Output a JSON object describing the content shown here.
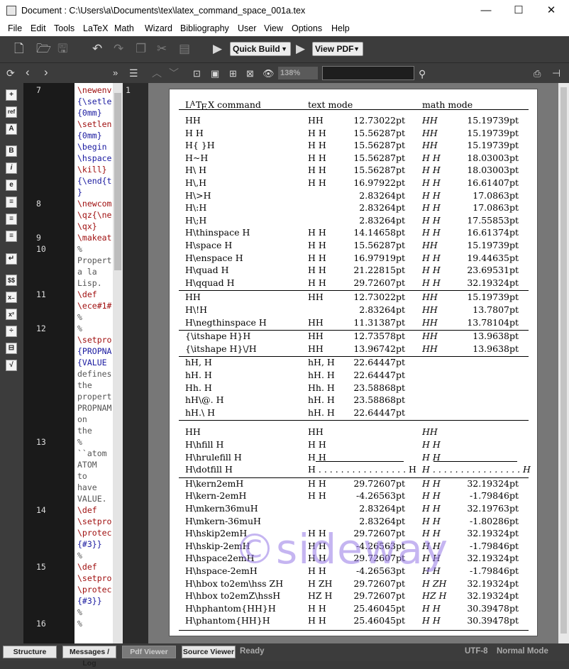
{
  "window": {
    "title": "Document : C:\\Users\\a\\Documents\\tex\\latex_command_space_001a.tex",
    "min": "—",
    "max": "☐",
    "close": "✕"
  },
  "menu": [
    "File",
    "Edit",
    "Tools",
    "LaTeX",
    "Math",
    "Wizard",
    "Bibliography",
    "User",
    "View",
    "Options",
    "Help"
  ],
  "toolbar": {
    "build_label": "Quick Build",
    "viewer_label": "View PDF",
    "zoom": "138%"
  },
  "line_numbers": [
    "7",
    "8",
    "9",
    "10",
    "11",
    "12",
    "13",
    "14",
    "15",
    "16"
  ],
  "pdf_page_number": "1",
  "code_lines": [
    "\\newenv",
    "{\\setle",
    "{0mm}",
    "\\setlen",
    "{0mm}",
    "\\begin",
    "\\hspace",
    "\\kill}",
    "{\\end{t",
    "}",
    "\\newcom",
    "\\qz{\\ne",
    "\\qx}",
    "\\makeat",
    "%",
    "Propert",
    "a la",
    "Lisp.",
    "\\def",
    "\\ece#1#",
    "%",
    "%",
    "\\setpro",
    "{PROPNA",
    "{VALUE",
    "defines",
    "the",
    "propert",
    "PROPNAM",
    "on",
    "the",
    "%",
    "``atom",
    "ATOM",
    "to",
    "have",
    "VALUE.",
    "\\def",
    "\\setpro",
    "\\protec",
    "{#3}}",
    "%",
    "\\def",
    "\\setpro",
    "\\protec",
    "{#3}}",
    "%",
    "%"
  ],
  "table": {
    "headers": [
      "LATEX command",
      "text mode",
      "math mode"
    ],
    "rows": [
      [
        "HH",
        "HH",
        "12.73022pt",
        "HH",
        "15.19739pt"
      ],
      [
        "H H",
        "H H",
        "15.56287pt",
        "HH",
        "15.19739pt"
      ],
      [
        "H{ }H",
        "H H",
        "15.56287pt",
        "HH",
        "15.19739pt"
      ],
      [
        "H~H",
        "H H",
        "15.56287pt",
        "H H",
        "18.03003pt"
      ],
      [
        "H\\ H",
        "H H",
        "15.56287pt",
        "H H",
        "18.03003pt"
      ],
      [
        "H\\,H",
        "H H",
        "16.97922pt",
        "H H",
        "16.61407pt"
      ],
      [
        "H\\>H",
        "",
        "2.83264pt",
        "H H",
        "17.0863pt"
      ],
      [
        "H\\:H",
        "",
        "2.83264pt",
        "H H",
        "17.0863pt"
      ],
      [
        "H\\;H",
        "",
        "2.83264pt",
        "H H",
        "17.55853pt"
      ],
      [
        "H\\thinspace H",
        "H H",
        "14.14658pt",
        "H H",
        "16.61374pt"
      ],
      [
        "H\\space H",
        "H H",
        "15.56287pt",
        "HH",
        "15.19739pt"
      ],
      [
        "H\\enspace H",
        "H H",
        "16.97919pt",
        "H H",
        "19.44635pt"
      ],
      [
        "H\\quad H",
        "H H",
        "21.22815pt",
        "H H",
        "23.69531pt"
      ],
      [
        "H\\qquad H",
        "H H",
        "29.72607pt",
        "H H",
        "32.19324pt"
      ],
      [
        "HH",
        "HH",
        "12.73022pt",
        "HH",
        "15.19739pt"
      ],
      [
        "H\\!H",
        "",
        "2.83264pt",
        "HH",
        "13.7807pt"
      ],
      [
        "H\\negthinspace H",
        "HH",
        "11.31387pt",
        "HH",
        "13.78104pt"
      ],
      [
        "{\\itshape H}H",
        "HH",
        "12.73578pt",
        "HH",
        "13.9638pt"
      ],
      [
        "{\\itshape H}\\/H",
        "HH",
        "13.96742pt",
        "HH",
        "13.9638pt"
      ],
      [
        "hH, H",
        "hH, H",
        "22.64447pt",
        "",
        ""
      ],
      [
        "hH. H",
        "hH. H",
        "22.64447pt",
        "",
        ""
      ],
      [
        "Hh. H",
        "Hh. H",
        "23.58868pt",
        "",
        ""
      ],
      [
        "hH\\@. H",
        "hH. H",
        "23.58868pt",
        "",
        ""
      ],
      [
        "hH.\\ H",
        "hH. H",
        "22.64447pt",
        "",
        ""
      ],
      [
        "HH",
        "HH",
        "",
        "HH",
        ""
      ],
      [
        "H\\hfill H",
        "H H",
        "",
        "H H",
        ""
      ],
      [
        "H\\hrulefill H",
        "H H",
        "",
        "H H",
        ""
      ],
      [
        "H\\dotfill H",
        "H . . . . . . . . . . . . . . . . H",
        "",
        "H . . . . . . . . . . . . . . . . H",
        ""
      ],
      [
        "H\\kern2emH",
        "H H",
        "29.72607pt",
        "H H",
        "32.19324pt"
      ],
      [
        "H\\kern-2emH",
        "H H",
        "-4.26563pt",
        "H H",
        "-1.79846pt"
      ],
      [
        "H\\mkern36muH",
        "",
        "2.83264pt",
        "H H",
        "32.19763pt"
      ],
      [
        "H\\mkern-36muH",
        "",
        "2.83264pt",
        "H H",
        "-1.80286pt"
      ],
      [
        "H\\hskip2emH",
        "H H",
        "29.72607pt",
        "H H",
        "32.19324pt"
      ],
      [
        "H\\hskip-2emH",
        "H H",
        "-4.26563pt",
        "H H",
        "-1.79846pt"
      ],
      [
        "H\\hspace2emH",
        "H H",
        "29.72607pt",
        "H H",
        "32.19324pt"
      ],
      [
        "H\\hspace-2emH",
        "H H",
        "-4.26563pt",
        "H H",
        "-1.79846pt"
      ],
      [
        "H\\hbox to2em\\hss ZH",
        "H ZH",
        "29.72607pt",
        "H ZH",
        "32.19324pt"
      ],
      [
        "H\\hbox to2emZ\\hssH",
        "HZ H",
        "29.72607pt",
        "HZ H",
        "32.19324pt"
      ],
      [
        "H\\hphantom{HH}H",
        "H H",
        "25.46045pt",
        "H H",
        "30.39478pt"
      ],
      [
        "H\\phantom{HH}H",
        "H H",
        "25.46045pt",
        "H H",
        "30.39478pt"
      ]
    ]
  },
  "watermark": "©sideway",
  "status": {
    "tabs": [
      "Structure",
      "Messages / Log",
      "Pdf Viewer",
      "Source Viewer"
    ],
    "state": "Ready",
    "encoding": "UTF-8",
    "mode": "Normal Mode"
  }
}
